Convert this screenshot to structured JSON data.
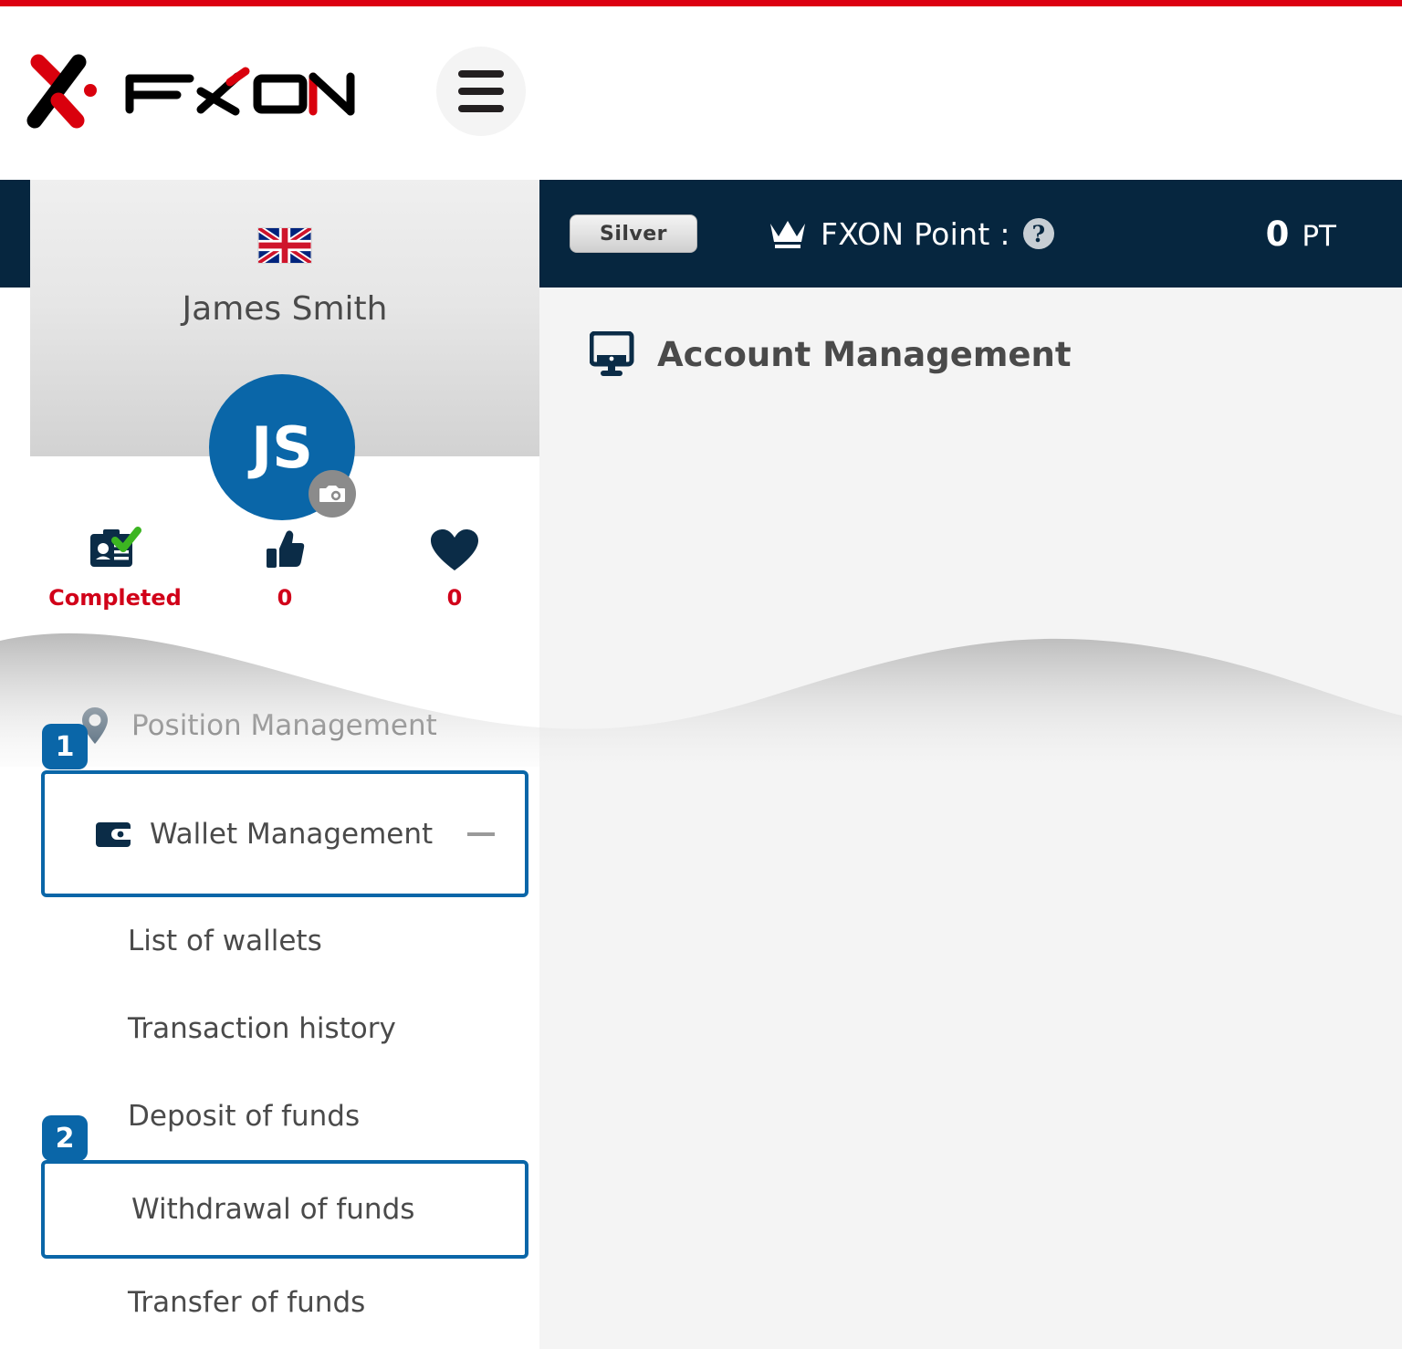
{
  "colors": {
    "red_strip": "#dc0011",
    "navy": "#06263f",
    "accent_blue": "#0a66a8",
    "stat_red": "#d10019",
    "text_gray": "#4a4a4a",
    "main_bg": "#f4f4f4"
  },
  "header": {
    "logo_text": "FXON",
    "menu_button_label": "menu"
  },
  "topbar": {
    "rank_badge": "Silver",
    "point_label": "FXON Point :",
    "help_label": "?",
    "point_value": "0",
    "point_unit": "PT"
  },
  "sidebar": {
    "language_flag": "united-kingdom-flag",
    "user_name": "James Smith",
    "avatar_initials": "JS",
    "camera_label": "camera",
    "stats": [
      {
        "icon": "id-card-verified-icon",
        "label": "Completed"
      },
      {
        "icon": "thumbs-up-icon",
        "label": "0"
      },
      {
        "icon": "heart-icon",
        "label": "0"
      }
    ],
    "menu": [
      {
        "icon": "location-pin-icon",
        "label": "Position Management",
        "highlighted": false,
        "badge": "1"
      },
      {
        "icon": "wallet-icon",
        "label": "Wallet Management",
        "highlighted": true,
        "collapse": "—"
      }
    ],
    "submenu": [
      {
        "label": "List of wallets",
        "highlighted": false
      },
      {
        "label": "Transaction history",
        "highlighted": false
      },
      {
        "label": "Deposit of funds",
        "highlighted": false,
        "badge": "2"
      },
      {
        "label": "Withdrawal of funds",
        "highlighted": true
      },
      {
        "label": "Transfer of funds",
        "highlighted": false
      }
    ],
    "step_badges": [
      "1",
      "2"
    ]
  },
  "main": {
    "icon": "monitor-icon",
    "page_title": "Account Management"
  }
}
